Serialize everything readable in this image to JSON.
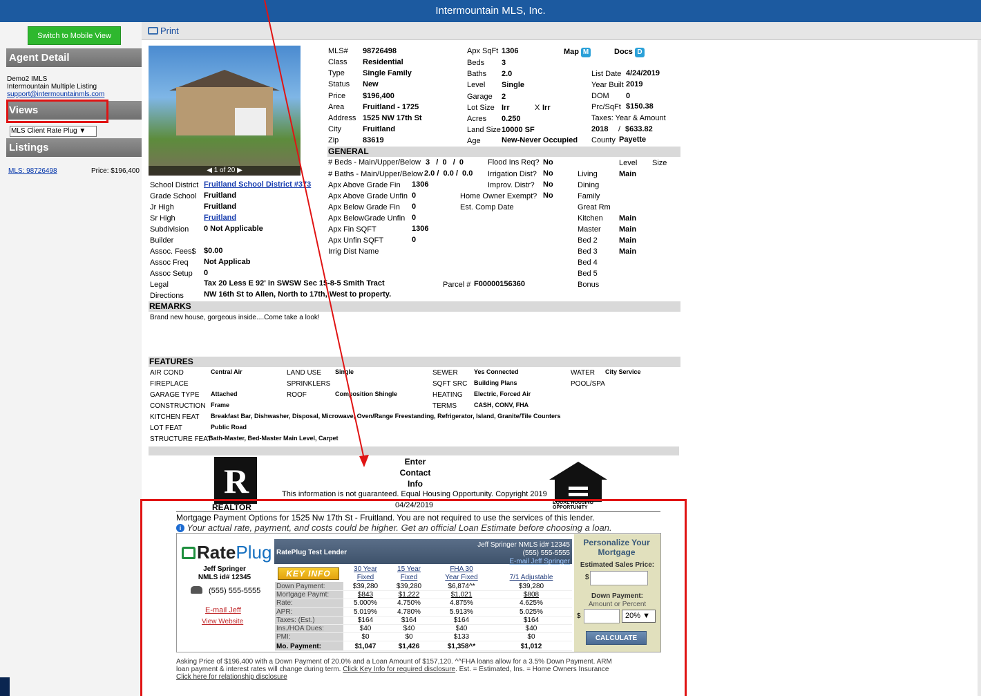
{
  "topbar": {
    "title": "Intermountain MLS, Inc."
  },
  "left": {
    "mobile_button": "Switch to Mobile View",
    "agent_heading": "Agent Detail",
    "agent_name": "Demo2 IMLS",
    "agent_org": "Intermountain Multiple Listing",
    "agent_email": "support@intermountainmls.com",
    "views_heading": "Views",
    "views_select": "MLS Client Rate Plug",
    "listings_heading": "Listings",
    "listing_mls": "MLS: 98726498",
    "listing_price": "Price: $196,400"
  },
  "toolbar": {
    "print": "Print"
  },
  "photo": {
    "caption": "◀ 1 of 20 ▶"
  },
  "summary": {
    "mls_label": "MLS#",
    "mls": "98726498",
    "class_label": "Class",
    "class": "Residential",
    "type_label": "Type",
    "type": "Single Family",
    "status_label": "Status",
    "status": "New",
    "price_label": "Price",
    "price": "$196,400",
    "area_label": "Area",
    "area": "Fruitland - 1725",
    "address_label": "Address",
    "address": "1525 NW 17th St",
    "city_label": "City",
    "city": "Fruitland",
    "zip_label": "Zip",
    "zip": "83619",
    "sqft_label": "Apx SqFt",
    "sqft": "1306",
    "beds_label": "Beds",
    "beds": "3",
    "baths_label": "Baths",
    "baths": "2.0",
    "level_label": "Level",
    "level": "Single",
    "garage_label": "Garage",
    "garage": "2",
    "lotsize_label": "Lot Size",
    "lotsize": "Irr",
    "lotsize_x": "X",
    "lotsize2": "Irr",
    "acres_label": "Acres",
    "acres": "0.250",
    "landsize_label": "Land Size",
    "landsize": "10000 SF",
    "age_label": "Age",
    "age": "New-Never Occupied",
    "map_label": "Map",
    "map_badge": "M",
    "docs_label": "Docs",
    "docs_badge": "D",
    "listdate_label": "List Date",
    "listdate": "4/24/2019",
    "yearbuilt_label": "Year Built",
    "yearbuilt": "2019",
    "dom_label": "DOM",
    "dom": "0",
    "prcsqft_label": "Prc/SqFt",
    "prcsqft": "$150.38",
    "taxes_label": "Taxes: Year & Amount",
    "tax_year": "2018",
    "tax_sep": "/",
    "tax_amount": "$633.82",
    "county_label": "County",
    "county": "Payette"
  },
  "school": {
    "district_label": "School District",
    "district": "Fruitland School District #373",
    "grade_label": "Grade School",
    "grade": "Fruitland",
    "jr_label": "Jr High",
    "jr": "Fruitland",
    "sr_label": "Sr High",
    "sr": "Fruitland",
    "subdiv_label": "Subdivision",
    "subdiv": "0 Not Applicable",
    "builder_label": "Builder",
    "fees_label": "Assoc. Fees$",
    "fees": "$0.00",
    "freq_label": "Assoc Freq",
    "freq": "Not Applicab",
    "setup_label": "Assoc Setup",
    "setup": "0",
    "legal_label": "Legal",
    "legal": "Tax 20 Less E 92' in SWSW Sec 15-8-5 Smith Tract",
    "dir_label": "Directions",
    "dir": "NW 16th St to Allen, North to 17th, West to property.",
    "parcel_label": "Parcel #",
    "parcel": "F00000156360"
  },
  "general": {
    "heading": "GENERAL",
    "beds_mub_label": "# Beds - Main/Upper/Below",
    "beds_mub": "3   /  0   /  0",
    "baths_mub_label": "# Baths - Main/Upper/Below",
    "baths_mub": "2.0 /  0.0 /  0.0",
    "above_fin_label": "Apx Above Grade Fin",
    "above_fin": "1306",
    "above_unfin_label": "Apx Above Grade Unfin",
    "above_unfin": "0",
    "below_fin_label": "Apx Below Grade Fin",
    "below_fin": "0",
    "below_unfin_label": "Apx BelowGrade Unfin",
    "below_unfin": "0",
    "fin_sqft_label": "Apx Fin SQFT",
    "fin_sqft": "1306",
    "unfin_sqft_label": "Apx Unfin SQFT",
    "unfin_sqft": "0",
    "irrig_name_label": "Irrig Dist Name",
    "flood_label": "Flood Ins Req?",
    "flood": "No",
    "irrig_label": "Irrigation Dist?",
    "irrig": "No",
    "improv_label": "Improv. Distr?",
    "improv": "No",
    "homeowner_label": "Home Owner Exempt?",
    "homeowner": "No",
    "comp_label": "Est. Comp Date",
    "rooms_level": "Level",
    "rooms_size": "Size",
    "rooms": [
      {
        "n": "Living",
        "l": "Main"
      },
      {
        "n": "Dining",
        "l": ""
      },
      {
        "n": "Family",
        "l": ""
      },
      {
        "n": "Great Rm",
        "l": ""
      },
      {
        "n": "Kitchen",
        "l": "Main"
      },
      {
        "n": "Master",
        "l": "Main"
      },
      {
        "n": "Bed 2",
        "l": "Main"
      },
      {
        "n": "Bed 3",
        "l": "Main"
      },
      {
        "n": "Bed 4",
        "l": ""
      },
      {
        "n": "Bed 5",
        "l": ""
      },
      {
        "n": "Bonus",
        "l": ""
      }
    ]
  },
  "remarks": {
    "heading": "REMARKS",
    "text": "Brand new house, gorgeous inside....Come take a look!"
  },
  "features": {
    "heading": "FEATURES",
    "air_label": "AIR COND",
    "air": "Central Air",
    "landuse_label": "LAND USE",
    "landuse": "Single",
    "sewer_label": "SEWER",
    "sewer": "Yes Connected",
    "water_label": "WATER",
    "water": "City Service",
    "fire_label": "FIREPLACE",
    "sprink_label": "SPRINKLERS",
    "sqftsrc_label": "SQFT SRC",
    "sqftsrc": "Building Plans",
    "pool_label": "POOL/SPA",
    "garage_label": "GARAGE TYPE",
    "garage": "Attached",
    "roof_label": "ROOF",
    "roof": "Composition Shingle",
    "heating_label": "HEATING",
    "heating": "Electric, Forced Air",
    "const_label": "CONSTRUCTION",
    "const": "Frame",
    "terms_label": "TERMS",
    "terms": "CASH, CONV, FHA",
    "kitchen_label": "KITCHEN FEAT",
    "kitchen": "Breakfast Bar, Dishwasher, Disposal, Microwave, Oven/Range Freestanding, Refrigerator, Island, Granite/Tile Counters",
    "lot_label": "LOT FEAT",
    "lot": "Public Road",
    "struct_label": "STRUCTURE FEAT",
    "struct": "Bath-Master, Bed-Master Main Level, Carpet"
  },
  "footer": {
    "realtor": "REALTOR",
    "contact1": "Enter",
    "contact2": "Contact",
    "contact3": "Info",
    "disclaimer": "This information is not guaranteed. Equal Housing Opportunity. Copyright 2019",
    "date": "04/24/2019",
    "eho1": "EQUAL HOUSING",
    "eho2": "OPPORTUNITY"
  },
  "rateplug": {
    "title": "Mortgage Payment Options for 1525 Nw 17th St - Fruitland. You are not required to use the services of this lender.",
    "subtitle": "Your actual rate, payment, and costs could be higher. Get an official Loan Estimate before choosing a loan.",
    "logo_a": "Rate",
    "logo_b": "Plug",
    "agent_name": "Jeff Springer",
    "agent_nmls": "NMLS id# 12345",
    "agent_phone": "(555) 555-5555",
    "email_link": "E-mail Jeff",
    "website_link": "View Website",
    "lender": "RatePlug Test Lender",
    "lender_contact": "Jeff Springer NMLS id# 12345",
    "lender_phone": "(555) 555-5555",
    "lender_email": "E-mail Jeff Springer",
    "key_info": "KEY INFO",
    "row_labels": [
      "Down Payment:",
      "Mortgage Paymt:",
      "Rate:",
      "APR:",
      "Taxes: (Est.)",
      "Ins./HOA Dues:",
      "PMI:",
      "Mo. Payment:"
    ],
    "loans": [
      {
        "h1": "30 Year",
        "h2": "Fixed",
        "v": [
          "$39,280",
          "$843",
          "5.000%",
          "5.019%",
          "$164",
          "$40",
          "$0",
          "$1,047"
        ]
      },
      {
        "h1": "15 Year",
        "h2": "Fixed",
        "v": [
          "$39,280",
          "$1,222",
          "4.750%",
          "4.780%",
          "$164",
          "$40",
          "$0",
          "$1,426"
        ]
      },
      {
        "h1": "FHA 30",
        "h2": "Year Fixed",
        "v": [
          "$6,874^*",
          "$1,021",
          "4.875%",
          "5.913%",
          "$164",
          "$40",
          "$133",
          "$1,358^*"
        ]
      },
      {
        "h1": "",
        "h2": "7/1 Adjustable",
        "v": [
          "$39,280",
          "$808",
          "4.625%",
          "5.025%",
          "$164",
          "$40",
          "$0",
          "$1,012"
        ]
      }
    ],
    "personalize": "Personalize Your Mortgage",
    "est_sales": "Estimated Sales Price:",
    "dollar": "$",
    "down_payment": "Down Payment:",
    "amount_or": "Amount or Percent",
    "pct": "20%",
    "calc": "CALCULATE",
    "foot1": "Asking Price of $196,400 with a Down Payment of 20.0% and a Loan Amount of $157,120. ^^FHA loans allow for a 3.5% Down Payment. ARM",
    "foot2a": "loan payment & interest rates will change during term. ",
    "foot2b": "Click Key Info for required disclosure",
    "foot2c": ". Est. = Estimated, Ins. = Home Owners Insurance",
    "foot3": "Click here for relationship disclosure"
  }
}
